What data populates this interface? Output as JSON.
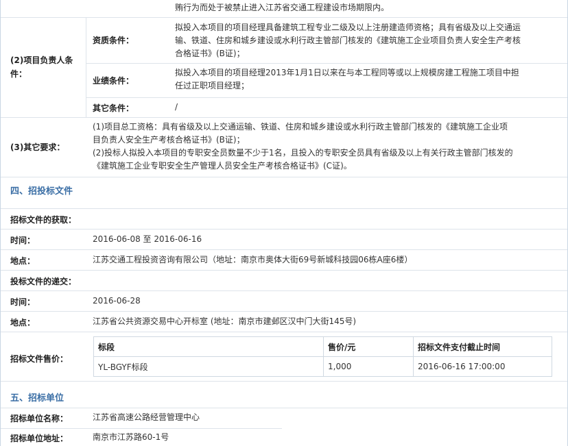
{
  "top_note": "贿行为而处于被禁止进入江苏省交通工程建设市场期限内。",
  "leader": {
    "label": "(2)项目负责人条件：",
    "qualification_label": "资质条件：",
    "qualification_line1": "拟投入本项目的项目经理具备建筑工程专业二级及以上注册建造师资格；具有省级及以上交通运",
    "qualification_line2": "输、铁道、住房和城乡建设或水利行政主管部门核发的《建筑施工企业项目负责人安全生产考核",
    "qualification_line3": "合格证书》(B证)；",
    "performance_label": "业绩条件：",
    "performance_line1": "拟投入本项目的项目经理2013年1月1日以来在与本工程同等或以上规模房建工程施工项目中担",
    "performance_line2": "任过正职项目经理；",
    "other_label": "其它条件：",
    "other_value": "/"
  },
  "other_req": {
    "label": "(3)其它要求：",
    "line1": "(1)项目总工资格：具有省级及以上交通运输、铁道、住房和城乡建设或水利行政主管部门核发的《建筑施工企业项",
    "line2": "目负责人安全生产考核合格证书》(B证)；",
    "line3": "(2)投标人拟投入本项目的专职安全员数量不少于1名，且投入的专职安全员具有省级及以上有关行政主管部门核发的",
    "line4": "《建筑施工企业专职安全生产管理人员安全生产考核合格证书》(C证)。"
  },
  "section4": {
    "title": "四、招投标文件",
    "obtain_label": "招标文件的获取：",
    "time_label": "时间：",
    "obtain_time": "2016-06-08 至 2016-06-16",
    "place_label": "地点：",
    "obtain_place": "江苏交通工程投资咨询有限公司（地址：南京市奥体大街69号新城科技园06栋A座6楼）",
    "submit_label": "投标文件的递交：",
    "time_label2": "时间：",
    "submit_time": "2016-06-28",
    "place_label2": "地点：",
    "submit_place": "江苏省公共资源交易中心开标室 (地址：南京市建邺区汉中门大街145号)",
    "price_label": "招标文件售价：",
    "price_table": {
      "headers": [
        "标段",
        "售价/元",
        "招标文件支付截止时间"
      ],
      "row": [
        "YL-BGYF标段",
        "1,000",
        "2016-06-16 17:00:00"
      ]
    }
  },
  "section5": {
    "title": "五、招标单位",
    "name_label": "招标单位名称：",
    "name_value": "江苏省高速公路经营管理中心",
    "addr_label": "招标单位地址：",
    "addr_value": "南京市江苏路60-1号"
  }
}
